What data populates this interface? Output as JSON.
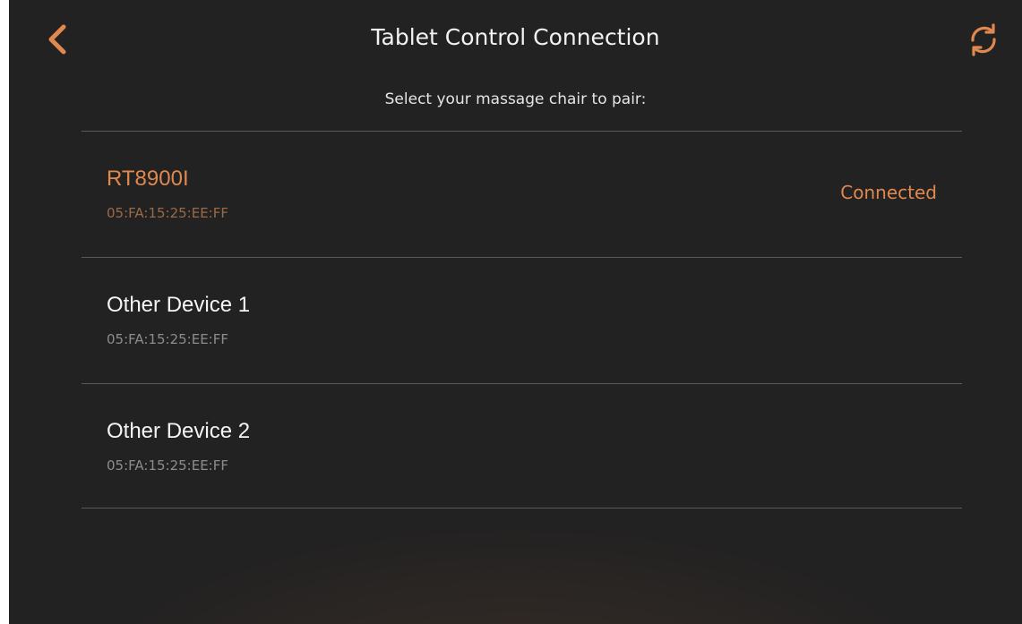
{
  "header": {
    "title": "Tablet Control Connection",
    "back_icon": "chevron-left-icon",
    "refresh_icon": "refresh-icon"
  },
  "instructions": "Select your massage chair to pair:",
  "devices": [
    {
      "name": "RT8900I",
      "mac": "05:FA:15:25:EE:FF",
      "status": "Connected"
    },
    {
      "name": "Other Device 1",
      "mac": "05:FA:15:25:EE:FF",
      "status": ""
    },
    {
      "name": "Other Device 2",
      "mac": "05:FA:15:25:EE:FF",
      "status": ""
    }
  ],
  "colors": {
    "background": "#232222",
    "accent": "#e0884e",
    "divider": "#5a5858",
    "secondary_text": "#8e8c8b"
  }
}
